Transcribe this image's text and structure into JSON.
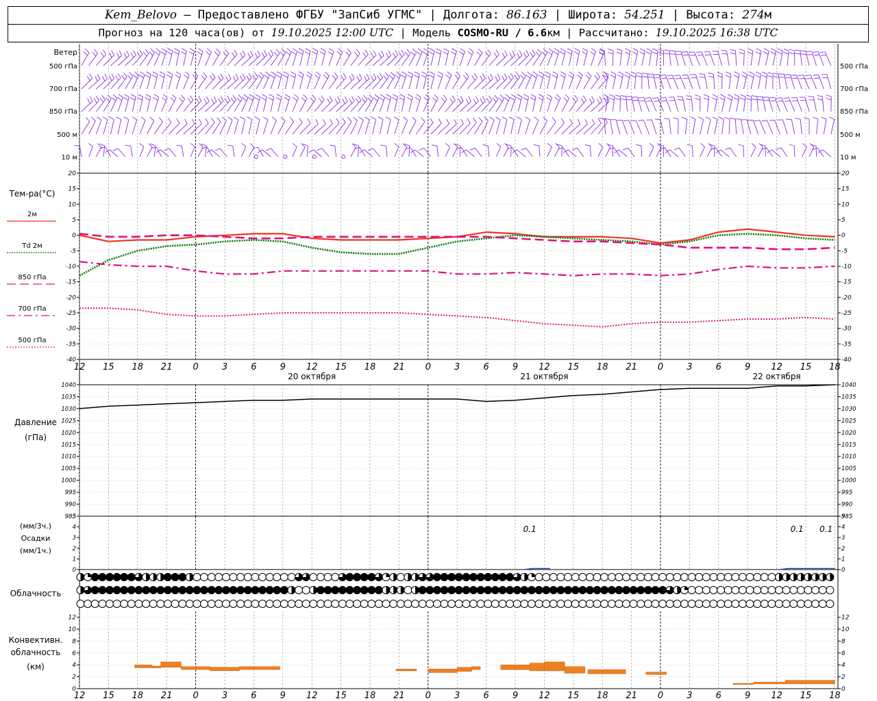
{
  "header": {
    "station": "Kem_Belovo",
    "provider": " – Предоставлено ФГБУ \"ЗапСиб УГМС\" | Долгота: ",
    "lon": "86.163",
    "lat_label": " | Широта: ",
    "lat": "54.251",
    "alt_label": " | Высота: ",
    "alt": "274",
    "alt_unit": "м",
    "fc_label": "Прогноз на 120 часа(ов) от ",
    "fc_time": "19.10.2025 12:00 UTC",
    "model_label": " | Модель ",
    "model": "COSMO-RU / 6.6",
    "model_unit": "км",
    "calc_label": " | Рассчитано: ",
    "calc_time": "19.10.2025 16:38 UTC"
  },
  "colors": {
    "wind": "#8a2be2",
    "t2m": "#ee3322",
    "td2m": "#007700",
    "t850": "#e0107c",
    "t700": "#e0107c",
    "t500": "#e0107c",
    "pressure": "#000000",
    "precip": "#1f3fbf",
    "convective": "#ee8022",
    "grid": "#000000"
  },
  "wind_panel": {
    "title": "Ветер",
    "levels": [
      "500 гПа",
      "700 гПа",
      "850 гПа",
      "500 м",
      "10 м"
    ]
  },
  "temp_panel": {
    "title": "Тем-ра(°C)",
    "legend": [
      {
        "label": "2м",
        "key": "t2m"
      },
      {
        "label": "Td 2м",
        "key": "td2m"
      },
      {
        "label": "850 гПа",
        "key": "t850"
      },
      {
        "label": "700 гПа",
        "key": "t700"
      },
      {
        "label": "500 гПа",
        "key": "t500"
      }
    ]
  },
  "pressure_panel": {
    "title": "Давление",
    "unit": "(гПа)"
  },
  "precip_panel": {
    "unit_top": "(мм/3ч.)",
    "title": "Осадки",
    "unit_bottom": "(мм/1ч.)"
  },
  "cloud_panel": {
    "title": "Облачность"
  },
  "conv_panel": {
    "title_1": "Конвективн.",
    "title_2": "облачность",
    "unit": "(км)"
  },
  "chart_data": {
    "type": "line",
    "time_hours": [
      12,
      15,
      18,
      21,
      0,
      3,
      6,
      9,
      12,
      15,
      18,
      21,
      0,
      3,
      6,
      9,
      12,
      15,
      18,
      21,
      0,
      3,
      6,
      9,
      12,
      15,
      18
    ],
    "time_labels": [
      "12",
      "15",
      "18",
      "21",
      "0",
      "3",
      "6",
      "9",
      "12",
      "15",
      "18",
      "21",
      "0",
      "3",
      "6",
      "9",
      "12",
      "15",
      "18",
      "21",
      "0",
      "3",
      "6",
      "9",
      "12",
      "15",
      "18"
    ],
    "day_labels": [
      {
        "index": 8,
        "label": "20 октября"
      },
      {
        "index": 16,
        "label": "21 октября"
      },
      {
        "index": 24,
        "label": "22 октября"
      }
    ],
    "temperature": {
      "ylim": [
        -40,
        20
      ],
      "ticks": [
        20,
        15,
        10,
        5,
        0,
        -5,
        -10,
        -15,
        -20,
        -25,
        -30,
        -35,
        -40
      ],
      "series": [
        {
          "name": "2м",
          "key": "t2m",
          "style": "solid",
          "values": [
            0.0,
            -2.0,
            -1.5,
            -1.5,
            -0.5,
            0.0,
            0.5,
            0.5,
            -1.0,
            -1.5,
            -1.5,
            -1.5,
            -1.0,
            -0.5,
            1.0,
            0.5,
            -0.5,
            -0.5,
            -0.5,
            -1.0,
            -2.5,
            -1.5,
            1.0,
            2.0,
            1.0,
            0.0,
            -0.5
          ]
        },
        {
          "name": "Td 2м",
          "key": "td2m",
          "style": "dotted",
          "values": [
            -13.0,
            -8.0,
            -5.0,
            -3.5,
            -3.0,
            -2.0,
            -1.5,
            -2.0,
            -4.0,
            -5.5,
            -6.0,
            -6.0,
            -4.0,
            -2.0,
            -1.0,
            0.0,
            -0.5,
            -1.0,
            -1.5,
            -2.0,
            -3.0,
            -2.0,
            0.0,
            0.5,
            0.0,
            -1.0,
            -1.5
          ]
        },
        {
          "name": "850 гПа",
          "key": "t850",
          "style": "dash",
          "values": [
            0.5,
            -0.5,
            -0.5,
            0.0,
            0.0,
            -0.5,
            -1.0,
            -1.0,
            -0.5,
            -0.5,
            -0.5,
            -0.5,
            -0.5,
            -0.5,
            -0.5,
            -1.0,
            -1.5,
            -2.0,
            -2.0,
            -2.5,
            -3.0,
            -4.0,
            -4.0,
            -4.0,
            -4.5,
            -4.5,
            -4.0
          ]
        },
        {
          "name": "700 гПа",
          "key": "t700",
          "style": "dashdot",
          "values": [
            -8.5,
            -9.5,
            -10.0,
            -10.0,
            -11.5,
            -12.5,
            -12.5,
            -11.5,
            -11.5,
            -11.5,
            -11.5,
            -11.5,
            -11.5,
            -12.5,
            -12.5,
            -12.0,
            -12.5,
            -13.0,
            -12.5,
            -12.5,
            -13.0,
            -12.5,
            -11.0,
            -10.0,
            -10.5,
            -10.5,
            -10.0
          ]
        },
        {
          "name": "500 гПа",
          "key": "t500",
          "style": "fine",
          "values": [
            -23.5,
            -23.5,
            -24.0,
            -25.5,
            -26.0,
            -26.0,
            -25.5,
            -25.0,
            -25.0,
            -25.0,
            -25.0,
            -25.0,
            -25.5,
            -26.0,
            -26.5,
            -27.5,
            -28.5,
            -29.0,
            -29.5,
            -28.5,
            -28.0,
            -28.0,
            -27.5,
            -27.0,
            -27.0,
            -26.5,
            -27.0
          ]
        }
      ]
    },
    "pressure": {
      "ylim": [
        985,
        1040
      ],
      "ticks": [
        1040,
        1035,
        1030,
        1025,
        1020,
        1015,
        1010,
        1005,
        1000,
        995,
        990,
        985
      ],
      "values": [
        1030.0,
        1031.0,
        1031.5,
        1032.0,
        1032.5,
        1033.0,
        1033.5,
        1033.5,
        1034.0,
        1034.0,
        1034.0,
        1034.0,
        1034.0,
        1034.0,
        1033.0,
        1033.5,
        1034.5,
        1035.5,
        1036.0,
        1037.0,
        1038.0,
        1038.5,
        1038.5,
        1038.5,
        1039.5,
        1039.5,
        1040.0
      ]
    },
    "precipitation": {
      "ylim": [
        0,
        5
      ],
      "ticks": [
        5,
        4,
        3,
        2,
        1,
        0
      ],
      "labels": [
        {
          "index": 15.5,
          "text": "0.1"
        },
        {
          "index": 24.7,
          "text": "0.1"
        },
        {
          "index": 25.7,
          "text": "0.1"
        }
      ],
      "segments": [
        {
          "from": 15.3,
          "to": 16.2,
          "value": 0.1
        },
        {
          "from": 24.1,
          "to": 26.0,
          "value": 0.1
        }
      ]
    },
    "cloudiness": {
      "rows": [
        {
          "name": "upper",
          "values": [
            0.5,
            0.25,
            1,
            1,
            1,
            1,
            1,
            1,
            0.75,
            0.5,
            0.5,
            0.5,
            1,
            1,
            1,
            0.5,
            0,
            0,
            0,
            0,
            0,
            0,
            0,
            0,
            0,
            0,
            0,
            0,
            0,
            0,
            0.75,
            0.75,
            0,
            0,
            0,
            0,
            0.75,
            1,
            1,
            1,
            1,
            0.75,
            0.25,
            0.5,
            0,
            0.5,
            0.5,
            0.75,
            0.75,
            1,
            1,
            1,
            1,
            1,
            1,
            1,
            1,
            1,
            1,
            1,
            0.75,
            0.5,
            0.25,
            0,
            0,
            0,
            0,
            0,
            0,
            0,
            0,
            0,
            0,
            0,
            0,
            0,
            0,
            0,
            0,
            0,
            0,
            0,
            0,
            0,
            0,
            0,
            0,
            0,
            0,
            0,
            0,
            0,
            0,
            0,
            0,
            0,
            0.5,
            0.5,
            0.5,
            0.5,
            0.5,
            0.5,
            0.5,
            0.5,
            0.5
          ]
        },
        {
          "name": "middle",
          "values": [
            0.5,
            0.75,
            1,
            1,
            1,
            1,
            1,
            1,
            1,
            1,
            1,
            1,
            1,
            1,
            1,
            1,
            1,
            1,
            1,
            1,
            1,
            1,
            1,
            1,
            1,
            1,
            1,
            1,
            1,
            0.5,
            0,
            0,
            0.5,
            1,
            1,
            1,
            1,
            1,
            1,
            1,
            1,
            1,
            0.5,
            0.5,
            0.5,
            0,
            0.5,
            1,
            1,
            1,
            1,
            1,
            1,
            1,
            1,
            1,
            1,
            1,
            1,
            1,
            1,
            1,
            1,
            1,
            1,
            1,
            1,
            1,
            1,
            1,
            1,
            1,
            1,
            1,
            1,
            1,
            1,
            1,
            1,
            1,
            1,
            0.75,
            0.5,
            0.25,
            0,
            0,
            0,
            0,
            0,
            0,
            0,
            0,
            0,
            0,
            0,
            0,
            0,
            0,
            0,
            0,
            0,
            0,
            0,
            0,
            0.5,
            0.5
          ]
        },
        {
          "name": "lower",
          "values": [
            0,
            0,
            0,
            0,
            0,
            0,
            0,
            0,
            0,
            0,
            0,
            0,
            0,
            0,
            0,
            0,
            0,
            0,
            0,
            0,
            0,
            0,
            0,
            0,
            0,
            0,
            0,
            0,
            0,
            0,
            0,
            0,
            0,
            0,
            0,
            0,
            0,
            0,
            0,
            0,
            0,
            0,
            0,
            0,
            0,
            0,
            0,
            0,
            0,
            0,
            0,
            0,
            0,
            0,
            0,
            0,
            0,
            0,
            0,
            0,
            0,
            0,
            0,
            0,
            0,
            0,
            0,
            0,
            0,
            0,
            0,
            0,
            0,
            0,
            0,
            0,
            0,
            0,
            0,
            0,
            0,
            0,
            0,
            0,
            0,
            0,
            0,
            0,
            0,
            0,
            0,
            0,
            0,
            0,
            0,
            0,
            0,
            0,
            0,
            0,
            0,
            0,
            0,
            0,
            0,
            0,
            0,
            0,
            0,
            0,
            0,
            0,
            0,
            0,
            0,
            0,
            0,
            0,
            0,
            0,
            0,
            0,
            0,
            0,
            0,
            0,
            0,
            0,
            0,
            0,
            0
          ]
        }
      ]
    },
    "convective": {
      "ylim": [
        0,
        13
      ],
      "ticks": [
        12,
        10,
        8,
        6,
        4,
        2,
        0
      ],
      "segments": [
        {
          "from": 1.9,
          "to": 2.5,
          "base": 3.5,
          "top": 4.0
        },
        {
          "from": 2.5,
          "to": 2.8,
          "base": 3.5,
          "top": 3.8
        },
        {
          "from": 2.8,
          "to": 3.5,
          "base": 3.6,
          "top": 4.5
        },
        {
          "from": 3.5,
          "to": 4.5,
          "base": 3.2,
          "top": 3.7
        },
        {
          "from": 4.5,
          "to": 5.5,
          "base": 3.0,
          "top": 3.6
        },
        {
          "from": 5.5,
          "to": 6.9,
          "base": 3.2,
          "top": 3.7
        },
        {
          "from": 10.9,
          "to": 11.6,
          "base": 3.0,
          "top": 3.3
        },
        {
          "from": 12.0,
          "to": 13.0,
          "base": 2.7,
          "top": 3.3
        },
        {
          "from": 13.0,
          "to": 13.5,
          "base": 2.9,
          "top": 3.6
        },
        {
          "from": 13.5,
          "to": 13.8,
          "base": 3.2,
          "top": 3.7
        },
        {
          "from": 14.5,
          "to": 15.5,
          "base": 3.2,
          "top": 4.0
        },
        {
          "from": 15.5,
          "to": 16.0,
          "base": 3.0,
          "top": 4.3
        },
        {
          "from": 16.0,
          "to": 16.7,
          "base": 3.0,
          "top": 4.5
        },
        {
          "from": 16.7,
          "to": 17.4,
          "base": 2.6,
          "top": 3.7
        },
        {
          "from": 17.5,
          "to": 18.8,
          "base": 2.5,
          "top": 3.2
        },
        {
          "from": 19.5,
          "to": 20.2,
          "base": 2.4,
          "top": 2.8
        },
        {
          "from": 22.5,
          "to": 23.2,
          "base": 0.7,
          "top": 0.9
        },
        {
          "from": 23.2,
          "to": 24.3,
          "base": 0.8,
          "top": 1.1
        },
        {
          "from": 24.3,
          "to": 26.0,
          "base": 0.8,
          "top": 1.4
        }
      ]
    }
  }
}
